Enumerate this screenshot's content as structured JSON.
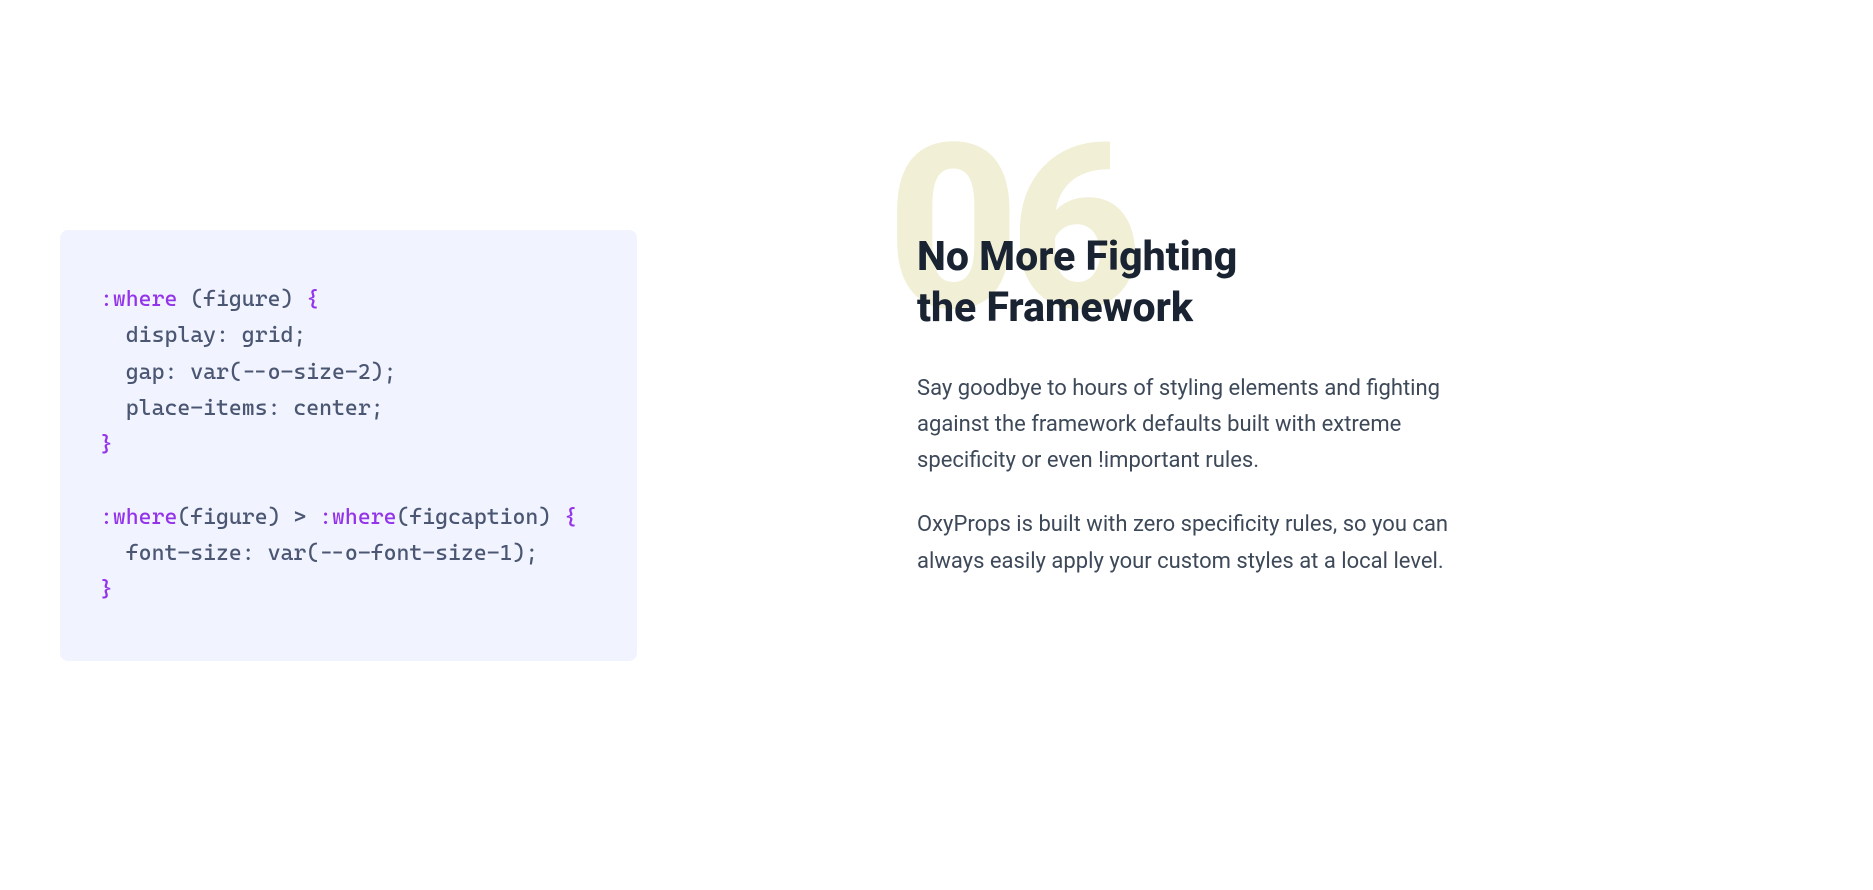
{
  "code": {
    "line1_sel": ":where ",
    "line1_paren_open": "(",
    "line1_arg": "figure",
    "line1_paren_close": ")",
    "line1_brace": " {",
    "line2": "  display: grid;",
    "line3": "  gap: var(--o-size-2);",
    "line4": "  place-items: center;",
    "line5_brace": "}",
    "line6": "",
    "line7_sel1": ":where",
    "line7_p1o": "(",
    "line7_a1": "figure",
    "line7_p1c": ")",
    "line7_gt": " > ",
    "line7_sel2": ":where",
    "line7_p2o": "(",
    "line7_a2": "figcaption",
    "line7_p2c": ")",
    "line7_brace": " {",
    "line8": "  font-size: var(--o-font-size-1);",
    "line9_brace": "}"
  },
  "section": {
    "number": "06",
    "heading_l1": "No More Fighting",
    "heading_l2": "the Framework",
    "p1": "Say goodbye to hours of styling elements and fighting against the framework defaults built with extreme specificity or even !important rules.",
    "p2": "OxyProps is built with zero specificity rules, so you can always easily apply your custom styles at a local level."
  }
}
